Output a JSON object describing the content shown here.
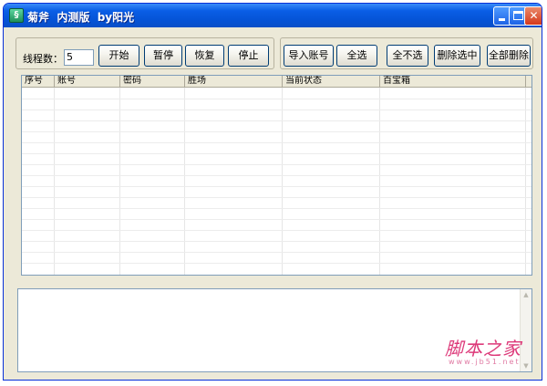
{
  "window": {
    "title": "菊斧  内测版  by阳光"
  },
  "controls": {
    "threads_label": "线程数：",
    "threads_value": "5"
  },
  "buttons_left": [
    "开始",
    "暂停",
    "恢复",
    "停止"
  ],
  "buttons_right": [
    "导入账号",
    "全选",
    "全不选",
    "删除选中",
    "全部删除"
  ],
  "table": {
    "columns": [
      "序号",
      "账号",
      "密码",
      "胜场",
      "当前状态",
      "百宝箱"
    ],
    "rows": []
  },
  "log": {
    "text": ""
  },
  "watermark": {
    "cn": "脚本之家",
    "url": "www.jb51.net"
  }
}
